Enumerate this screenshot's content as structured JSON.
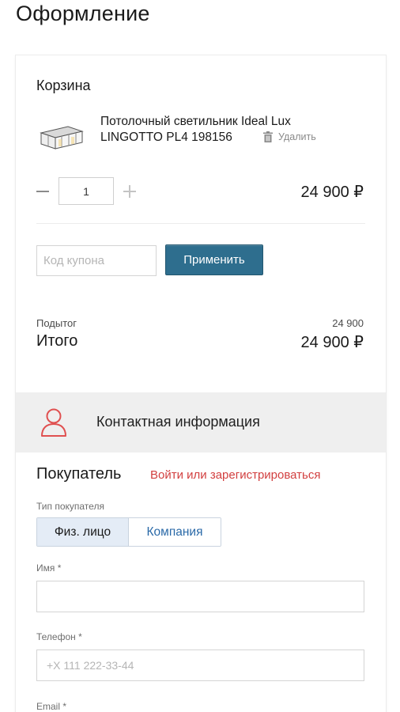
{
  "page": {
    "title": "Оформление"
  },
  "cart": {
    "title": "Корзина",
    "item": {
      "name": "Потолочный светильник Ideal Lux LINGOTTO PL4 198156",
      "delete_label": "Удалить",
      "quantity": "1",
      "price": "24 900 ₽"
    },
    "coupon": {
      "placeholder": "Код купона",
      "apply_label": "Применить"
    },
    "subtotal_label": "Подытог",
    "subtotal_value": "24 900",
    "total_label": "Итого",
    "total_value": "24 900 ₽"
  },
  "contact": {
    "title": "Контактная информация",
    "icon": "user-icon",
    "accent_color": "#e05050"
  },
  "buyer": {
    "title": "Покупатель",
    "login_link": "Войти или зарегистрироваться",
    "type_label": "Тип покупателя",
    "types": [
      {
        "label": "Физ. лицо",
        "selected": true
      },
      {
        "label": "Компания",
        "selected": false
      }
    ],
    "name_label": "Имя *",
    "name_value": "",
    "phone_label": "Телефон *",
    "phone_placeholder": "+X 111 222-33-44",
    "email_label": "Email *"
  },
  "colors": {
    "primary_button": "#2e6e8e",
    "link_red": "#d23f3f",
    "link_blue": "#2b6aa8"
  }
}
